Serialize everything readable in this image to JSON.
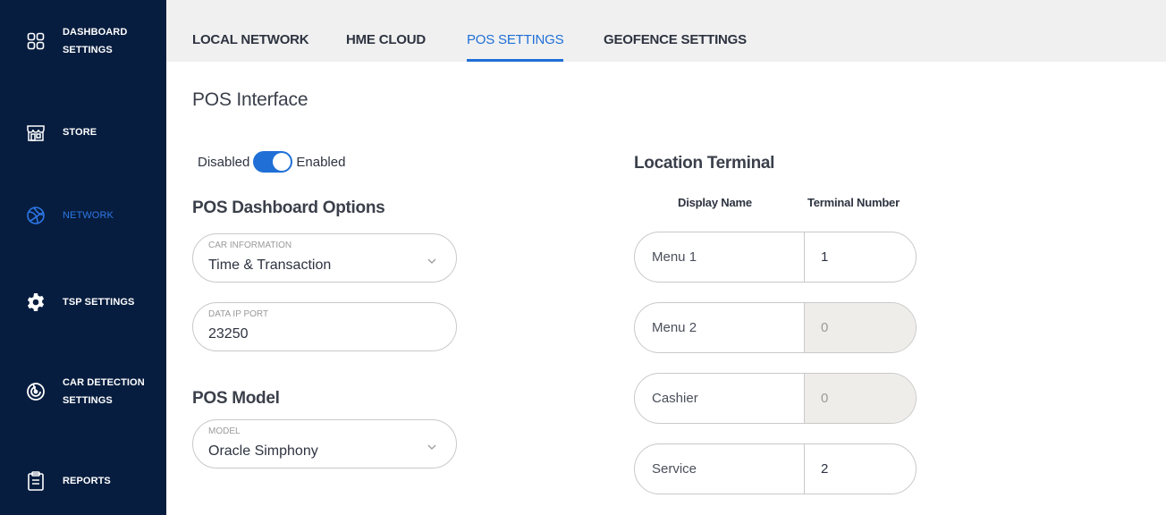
{
  "sidebar": {
    "items": [
      {
        "line1": "DASHBOARD",
        "line2": "SETTINGS",
        "icon": "dashboard-grid-icon",
        "active": false
      },
      {
        "line1": "STORE",
        "line2": "",
        "icon": "store-icon",
        "active": false
      },
      {
        "line1": "NETWORK",
        "line2": "",
        "icon": "network-globe-icon",
        "active": true
      },
      {
        "line1": "TSP SETTINGS",
        "line2": "",
        "icon": "gear-icon",
        "active": false
      },
      {
        "line1": "CAR DETECTION",
        "line2": "SETTINGS",
        "icon": "radar-icon",
        "active": false
      },
      {
        "line1": "REPORTS",
        "line2": "",
        "icon": "clipboard-icon",
        "active": false
      }
    ]
  },
  "tabs": [
    {
      "label": "LOCAL NETWORK",
      "active": false
    },
    {
      "label": "HME CLOUD",
      "active": false
    },
    {
      "label": "POS SETTINGS",
      "active": true
    },
    {
      "label": "GEOFENCE SETTINGS",
      "active": false
    }
  ],
  "pos": {
    "title": "POS Interface",
    "toggle": {
      "off_label": "Disabled",
      "on_label": "Enabled",
      "enabled": true
    },
    "dashboard_options_title": "POS Dashboard Options",
    "car_information": {
      "caption": "CAR INFORMATION",
      "value": "Time & Transaction"
    },
    "data_ip_port": {
      "caption": "DATA IP PORT",
      "value": "23250"
    },
    "model_title": "POS Model",
    "model": {
      "caption": "MODEL",
      "value": "Oracle Simphony"
    }
  },
  "location_terminal": {
    "title": "Location Terminal",
    "col_display_name": "Display Name",
    "col_terminal_number": "Terminal Number",
    "rows": [
      {
        "name": "Menu 1",
        "number": "1",
        "disabled": false
      },
      {
        "name": "Menu 2",
        "number": "0",
        "disabled": true
      },
      {
        "name": "Cashier",
        "number": "0",
        "disabled": true
      },
      {
        "name": "Service",
        "number": "2",
        "disabled": false
      }
    ]
  },
  "colors": {
    "sidebar_bg": "#071d3f",
    "accent": "#1f6fd6",
    "tabbar_bg": "#f0f0f0",
    "disabled_field_bg": "#eeede9"
  }
}
